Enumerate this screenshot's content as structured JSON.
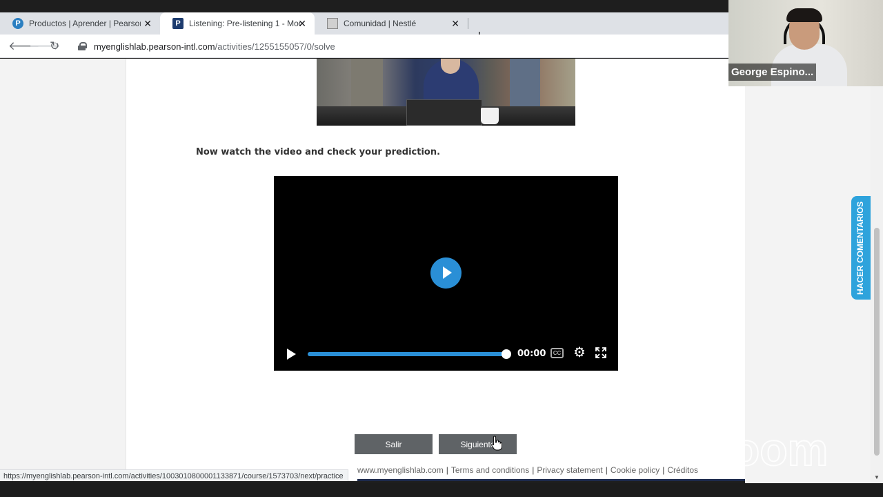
{
  "browser": {
    "tabs": [
      {
        "title": "Productos | Aprender | Pearson E",
        "favicon": "pearson-circle-icon",
        "active": false
      },
      {
        "title": "Listening: Pre-listening 1 - Modo",
        "favicon": "pearson-p-icon",
        "active": true
      },
      {
        "title": "Comunidad | Nestlé",
        "favicon": "page-icon",
        "active": false
      }
    ],
    "new_tab": "+",
    "url_host": "myenglishlab.pearson-intl.com",
    "url_path": "/activities/1255155057/0/solve",
    "status_url": "https://myenglishlab.pearson-intl.com/activities/1003010800001133871/course/1573703/next/practice"
  },
  "activity": {
    "instruction": "Now watch the video and check your prediction.",
    "video": {
      "time": "00:00",
      "progress": 1.0,
      "cc_label": "CC"
    }
  },
  "buttons": {
    "exit": "Salir",
    "next": "Siguiente"
  },
  "footer": {
    "links": [
      "www.myenglishlab.com",
      "Terms and conditions",
      "Privacy statement",
      "Cookie policy",
      "Créditos"
    ],
    "separator": "|"
  },
  "feedback_tab": "HACER COMENTARIOS",
  "zoom": {
    "participant_name": "George Espino...",
    "watermark": "zoom"
  },
  "colors": {
    "accent_blue": "#2a8fd6",
    "button_gray": "#5f6366",
    "feedback_blue": "#2ea3dc"
  }
}
